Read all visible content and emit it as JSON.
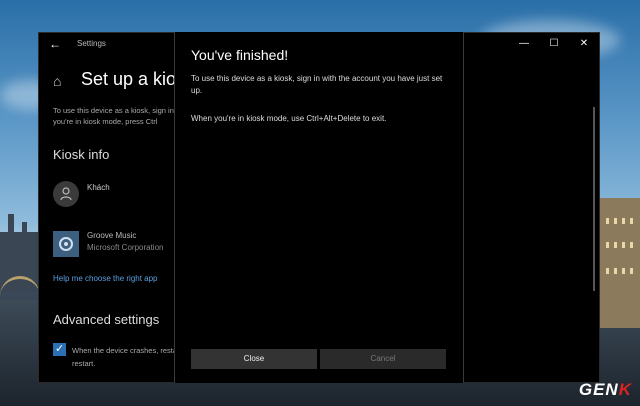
{
  "window": {
    "title": "Settings",
    "controls": [
      "—",
      "☐",
      "✕"
    ]
  },
  "settings": {
    "page_title": "Set up a kiosk",
    "description_line1": "To use this device as a kiosk, sign in with the account you have just set up.",
    "description_line2": "you're in kiosk mode, press Ctrl",
    "kiosk_info_title": "Kiosk info",
    "user_name": "Khách",
    "app_name": "Groove Music",
    "app_publisher": "Microsoft Corporation",
    "help_link": "Help me choose the right app",
    "advanced_title": "Advanced settings",
    "crash_option_line1": "When the device crashes, restart.",
    "crash_option_line2": "restart."
  },
  "dialog": {
    "title": "You've finished!",
    "text1": "To use this device as a kiosk, sign in with the account you have just set up.",
    "text2": "When you're in kiosk mode, use Ctrl+Alt+Delete to exit.",
    "close_label": "Close",
    "cancel_label": "Cancel"
  },
  "watermark": {
    "brand_a": "GEN",
    "brand_b": "K"
  },
  "colors": {
    "accent": "#2b6fb5",
    "link": "#5aa0e0",
    "app_tile": "#3d5f7f"
  },
  "icons": {
    "back": "back-arrow-icon",
    "home": "home-icon",
    "avatar": "person-icon",
    "app": "groove-music-icon"
  }
}
